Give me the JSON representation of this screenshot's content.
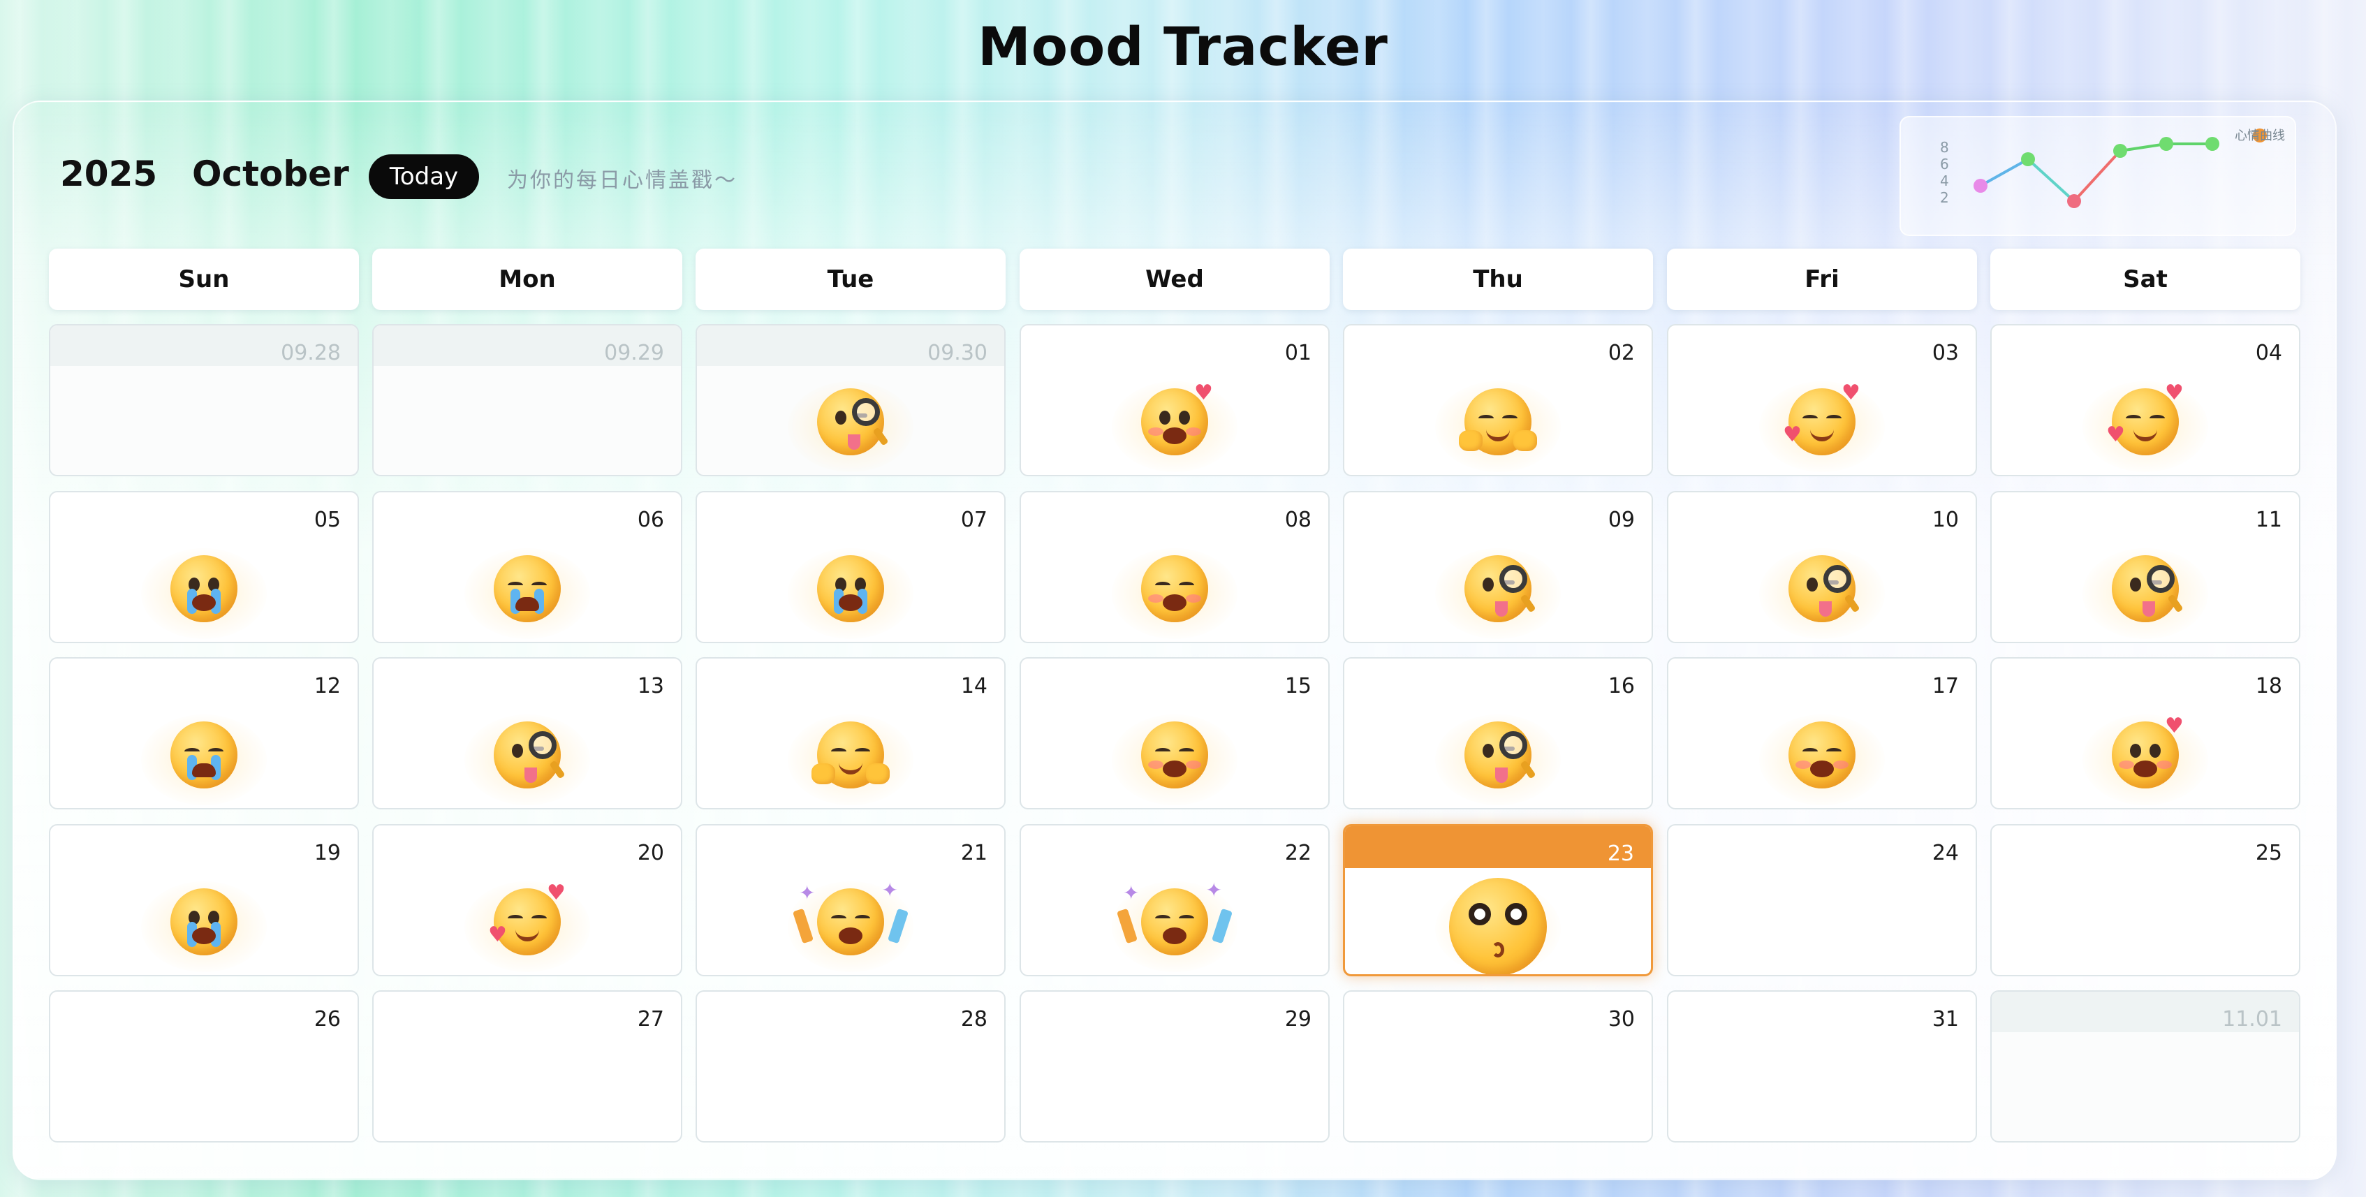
{
  "app": {
    "title": "Mood Tracker"
  },
  "header": {
    "year": "2025",
    "month": "October",
    "today_label": "Today",
    "subtitle": "为你的每日心情盖戳～"
  },
  "mini_chart": {
    "legend_label": "心情曲线",
    "y_ticks": [
      "8",
      "6",
      "4",
      "2"
    ],
    "colors": {
      "line_down": "#ef6c6c",
      "line_up": "#5fd36a",
      "line_first": "#5fb4e8",
      "accent": "#ef9434"
    }
  },
  "weekdays": [
    "Sun",
    "Mon",
    "Tue",
    "Wed",
    "Thu",
    "Fri",
    "Sat"
  ],
  "weeks": [
    [
      {
        "label": "09.28",
        "outside": true,
        "mood": ""
      },
      {
        "label": "09.29",
        "outside": true,
        "mood": ""
      },
      {
        "label": "09.30",
        "outside": true,
        "mood": "curious"
      },
      {
        "label": "01",
        "outside": false,
        "mood": "shy"
      },
      {
        "label": "02",
        "outside": false,
        "mood": "hug"
      },
      {
        "label": "03",
        "outside": false,
        "mood": "love"
      },
      {
        "label": "04",
        "outside": false,
        "mood": "love"
      }
    ],
    [
      {
        "label": "05",
        "outside": false,
        "mood": "cry"
      },
      {
        "label": "06",
        "outside": false,
        "mood": "sob"
      },
      {
        "label": "07",
        "outside": false,
        "mood": "cry"
      },
      {
        "label": "08",
        "outside": false,
        "mood": "relieved"
      },
      {
        "label": "09",
        "outside": false,
        "mood": "curious"
      },
      {
        "label": "10",
        "outside": false,
        "mood": "curious"
      },
      {
        "label": "11",
        "outside": false,
        "mood": "curious"
      }
    ],
    [
      {
        "label": "12",
        "outside": false,
        "mood": "sob"
      },
      {
        "label": "13",
        "outside": false,
        "mood": "curious"
      },
      {
        "label": "14",
        "outside": false,
        "mood": "hug"
      },
      {
        "label": "15",
        "outside": false,
        "mood": "relieved"
      },
      {
        "label": "16",
        "outside": false,
        "mood": "curious"
      },
      {
        "label": "17",
        "outside": false,
        "mood": "relieved"
      },
      {
        "label": "18",
        "outside": false,
        "mood": "shy"
      }
    ],
    [
      {
        "label": "19",
        "outside": false,
        "mood": "cry"
      },
      {
        "label": "20",
        "outside": false,
        "mood": "love"
      },
      {
        "label": "21",
        "outside": false,
        "mood": "party"
      },
      {
        "label": "22",
        "outside": false,
        "mood": "party"
      },
      {
        "label": "23",
        "outside": false,
        "mood": "kiss",
        "today": true
      },
      {
        "label": "24",
        "outside": false,
        "mood": ""
      },
      {
        "label": "25",
        "outside": false,
        "mood": ""
      }
    ],
    [
      {
        "label": "26",
        "outside": false,
        "mood": ""
      },
      {
        "label": "27",
        "outside": false,
        "mood": ""
      },
      {
        "label": "28",
        "outside": false,
        "mood": ""
      },
      {
        "label": "29",
        "outside": false,
        "mood": ""
      },
      {
        "label": "30",
        "outside": false,
        "mood": ""
      },
      {
        "label": "31",
        "outside": false,
        "mood": ""
      },
      {
        "label": "11.01",
        "outside": true,
        "mood": ""
      }
    ]
  ],
  "colors": {
    "today_accent": "#ef9434",
    "header_button": "#0a0a0a"
  }
}
